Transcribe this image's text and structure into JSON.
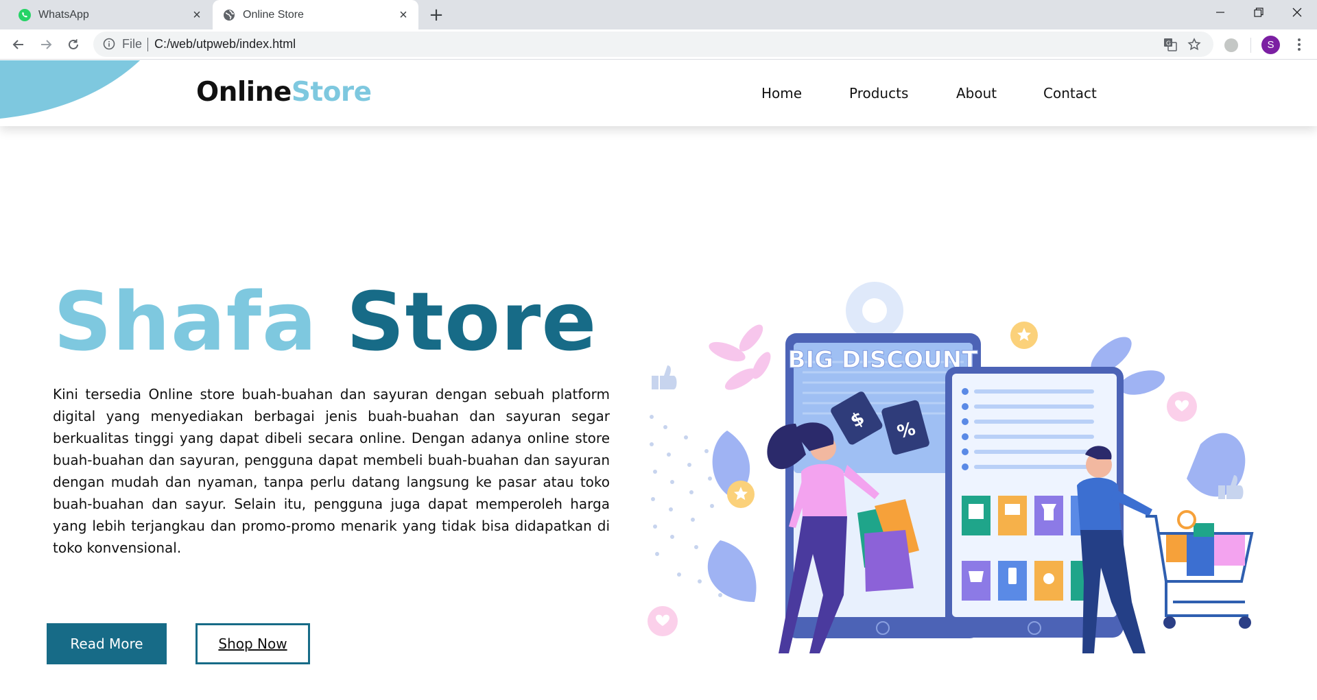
{
  "browser": {
    "tabs": [
      {
        "title": "WhatsApp",
        "icon": "whatsapp-icon",
        "active": false
      },
      {
        "title": "Online Store",
        "icon": "globe-icon",
        "active": true
      }
    ],
    "address": {
      "scheme_label": "File",
      "url": "C:/web/utpweb/index.html"
    },
    "profile_initial": "S"
  },
  "site": {
    "logo": {
      "part1": "Online",
      "part2": "Store"
    },
    "nav": [
      "Home",
      "Products",
      "About",
      "Contact"
    ],
    "hero": {
      "title_part1": "Shafa",
      "title_part2": "Store",
      "description": "Kini tersedia Online store buah-buahan dan sayuran dengan sebuah platform digital yang menyediakan berbagai jenis buah-buahan dan sayuran segar berkualitas tinggi yang dapat dibeli secara online. Dengan adanya online store buah-buahan dan sayuran, pengguna dapat membeli buah-buahan dan sayuran dengan mudah dan nyaman, tanpa perlu datang langsung ke pasar atau toko buah-buahan dan sayur. Selain itu, pengguna juga dapat memperoleh harga yang lebih terjangkau dan promo-promo menarik yang tidak bisa didapatkan di toko konvensional.",
      "buttons": {
        "read_more": "Read More",
        "shop_now": "Shop Now"
      }
    },
    "illustration": {
      "banner_text": "BIG DISCOUNT",
      "tag_dollar": "$",
      "tag_percent": "%"
    }
  },
  "colors": {
    "accent_light": "#7ec8df",
    "accent_dark": "#176b87",
    "chrome_bg": "#dee1e6"
  }
}
